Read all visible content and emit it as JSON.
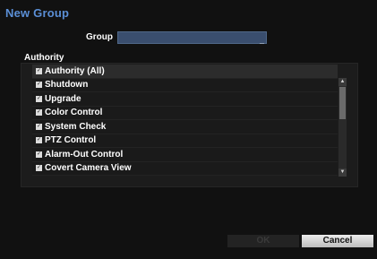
{
  "dialog": {
    "title": "New Group"
  },
  "group": {
    "label": "Group",
    "value": "",
    "cursor": "_"
  },
  "authority": {
    "label": "Authority",
    "items": [
      {
        "label": "Authority (All)",
        "checked": true
      },
      {
        "label": "Shutdown",
        "checked": true
      },
      {
        "label": "Upgrade",
        "checked": true
      },
      {
        "label": "Color Control",
        "checked": true
      },
      {
        "label": "System Check",
        "checked": true
      },
      {
        "label": "PTZ Control",
        "checked": true
      },
      {
        "label": "Alarm-Out Control",
        "checked": true
      },
      {
        "label": "Covert Camera View",
        "checked": true
      }
    ]
  },
  "buttons": {
    "ok": "OK",
    "cancel": "Cancel"
  },
  "colors": {
    "title": "#5b8fd6",
    "input_bg": "#3a4e6e",
    "background": "#111111"
  }
}
